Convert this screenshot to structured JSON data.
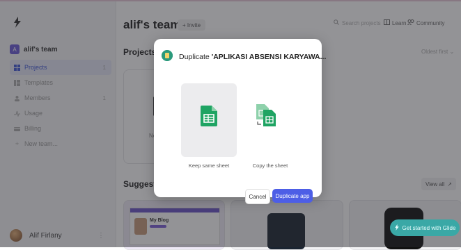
{
  "sidebar": {
    "team": {
      "badge": "A",
      "name": "alif's team"
    },
    "items": [
      {
        "label": "Projects",
        "count": "1",
        "icon": "grid-icon",
        "active": true
      },
      {
        "label": "Templates",
        "icon": "template-icon"
      },
      {
        "label": "Members",
        "count": "1",
        "icon": "members-icon"
      },
      {
        "label": "Usage",
        "icon": "usage-icon"
      },
      {
        "label": "Billing",
        "icon": "billing-icon"
      },
      {
        "label": "New team...",
        "icon": "plus-icon"
      }
    ],
    "user": {
      "name": "Alif Firlany"
    }
  },
  "header": {
    "title": "alif's team",
    "invite": "+ Invite",
    "search_placeholder": "Search projects",
    "learn": "Learn",
    "community": "Community"
  },
  "main": {
    "projects_title": "Projects",
    "sort": "Oldest first",
    "project_name": "Ne",
    "suggested_title": "Suggeste",
    "view_all": "View all",
    "sugg_blog_title": "My Blog",
    "get_started": "Get started with Glide"
  },
  "modal": {
    "title_prefix": "Duplicate ",
    "title_app": "'APLIKASI ABSENSI KARYAWA...",
    "options": [
      {
        "label": "Keep same sheet",
        "selected": true
      },
      {
        "label": "Copy the sheet",
        "selected": false
      }
    ],
    "cancel": "Cancel",
    "confirm": "Duplicate app"
  },
  "colors": {
    "accent": "#4d5ee6",
    "sheet_green": "#1fa463",
    "teal": "#3aa8a6"
  }
}
